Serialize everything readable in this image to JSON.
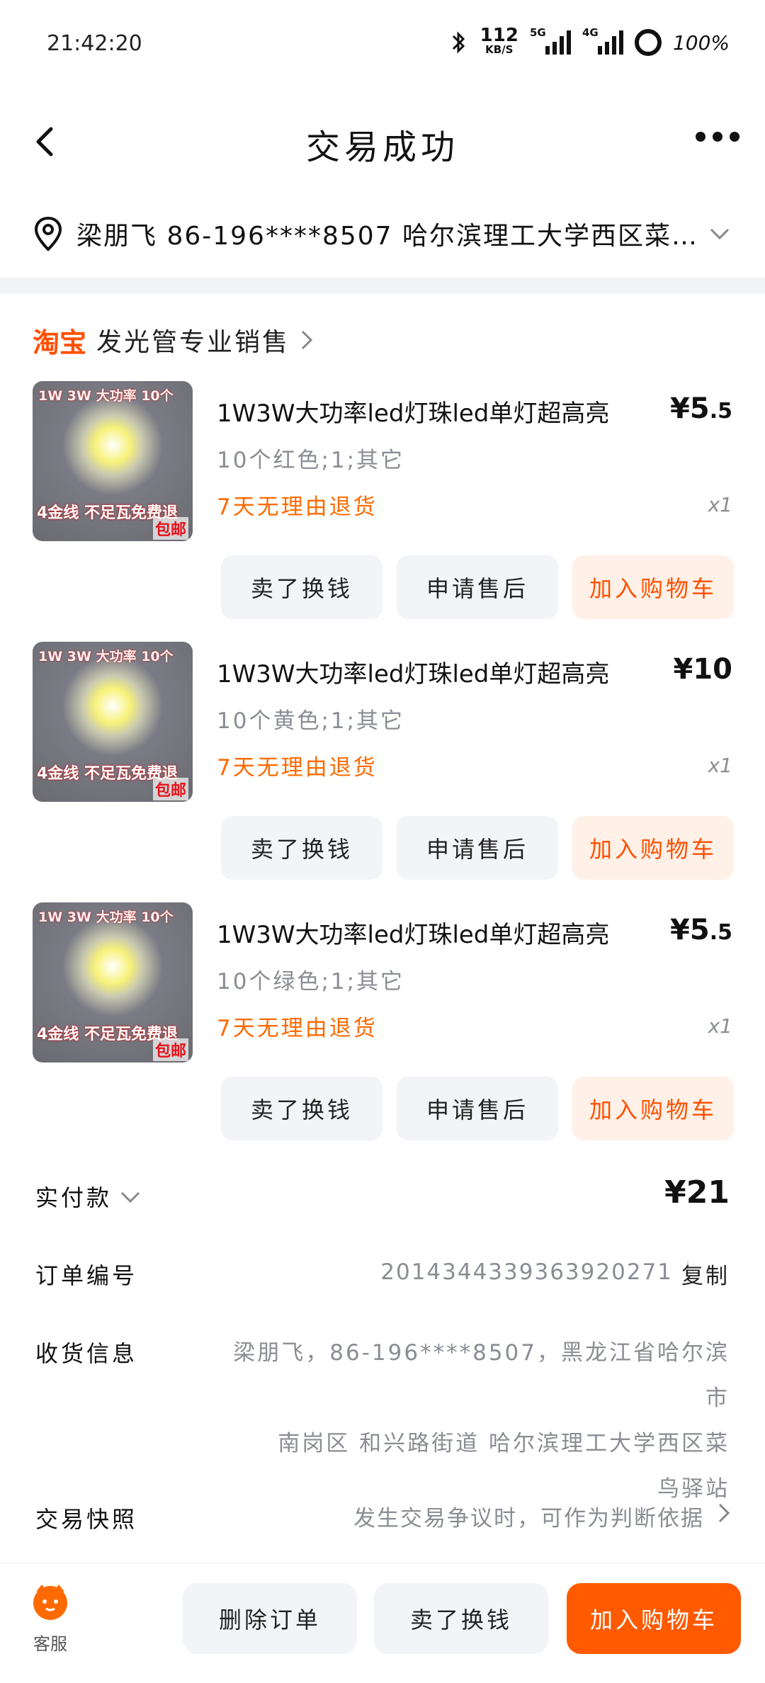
{
  "status": {
    "time": "21:42:20",
    "speed_value": "112",
    "speed_unit": "KB/S",
    "net1": "5G",
    "net2": "4G",
    "battery": "100%"
  },
  "header": {
    "title": "交易成功"
  },
  "address": {
    "text": "梁朋飞  86-196****8507  哈尔滨理工大学西区菜鸟..."
  },
  "shop": {
    "logo": "淘宝",
    "name": "发光管专业销售"
  },
  "items": [
    {
      "thumb_top": "1W 3W 大功率 10个",
      "thumb_bottom": "4金线 不足瓦免费退",
      "thumb_badge": "包邮",
      "title": "1W3W大功率led灯珠led单灯超高亮",
      "price_main": "¥5",
      "price_dec": ".5",
      "spec": "10个红色;1;其它",
      "return": "7天无理由退货",
      "qty": "x1",
      "btn_sell": "卖了换钱",
      "btn_aftersale": "申请售后",
      "btn_cart": "加入购物车"
    },
    {
      "thumb_top": "1W 3W 大功率 10个",
      "thumb_bottom": "4金线 不足瓦免费退",
      "thumb_badge": "包邮",
      "title": "1W3W大功率led灯珠led单灯超高亮",
      "price_main": "¥10",
      "price_dec": "",
      "spec": "10个黄色;1;其它",
      "return": "7天无理由退货",
      "qty": "x1",
      "btn_sell": "卖了换钱",
      "btn_aftersale": "申请售后",
      "btn_cart": "加入购物车"
    },
    {
      "thumb_top": "1W 3W 大功率 10个",
      "thumb_bottom": "4金线 不足瓦免费退",
      "thumb_badge": "包邮",
      "title": "1W3W大功率led灯珠led单灯超高亮",
      "price_main": "¥5",
      "price_dec": ".5",
      "spec": "10个绿色;1;其它",
      "return": "7天无理由退货",
      "qty": "x1",
      "btn_sell": "卖了换钱",
      "btn_aftersale": "申请售后",
      "btn_cart": "加入购物车"
    }
  ],
  "payment": {
    "label": "实付款",
    "amount": "¥21"
  },
  "order": {
    "label": "订单编号",
    "number": "2014344339363920271",
    "copy": "复制"
  },
  "delivery": {
    "label": "收货信息",
    "line1": "梁朋飞，86-196****8507，黑龙江省哈尔滨市",
    "line2": "南岗区 和兴路街道 哈尔滨理工大学西区菜",
    "line3": "鸟驿站"
  },
  "snapshot": {
    "label": "交易快照",
    "value": "发生交易争议时，可作为判断依据"
  },
  "bottom": {
    "cs_label": "客服",
    "delete": "删除订单",
    "sell": "卖了换钱",
    "cart": "加入购物车"
  },
  "colors": {
    "accent": "#ff5000",
    "accent_bg": "#fff1e8",
    "muted": "#8a8d93"
  }
}
